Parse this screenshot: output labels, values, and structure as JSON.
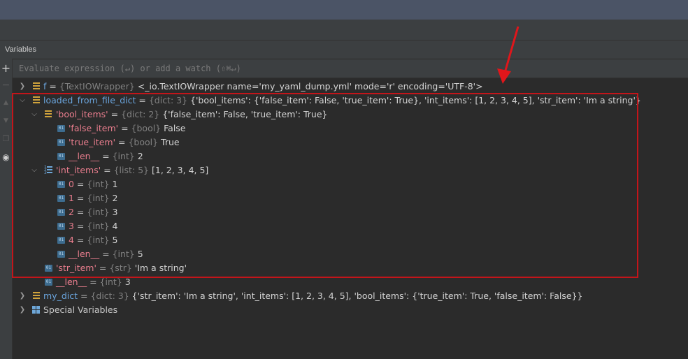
{
  "panel": {
    "title": "Variables"
  },
  "eval": {
    "placeholder": "Evaluate expression (↵) or add a watch (⇧⌘↵)"
  },
  "gutter_icons": [
    "plus-icon",
    "minus-icon",
    "up-icon",
    "down-icon",
    "copy-icon",
    "eye-icon"
  ],
  "rows": [
    {
      "name": "f",
      "eq": " = ",
      "type": "{TextIOWrapper}",
      "value": " <_io.TextIOWrapper name='my_yaml_dump.yml' mode='r' encoding='UTF-8'>"
    },
    {
      "name": "loaded_from_file_dict",
      "eq": " = ",
      "type": "{dict: 3}",
      "value": " {'bool_items': {'false_item': False, 'true_item': True}, 'int_items': [1, 2, 3, 4, 5], 'str_item': 'Im a string'}"
    },
    {
      "name": "'bool_items'",
      "eq": " = ",
      "type": "{dict: 2}",
      "value": " {'false_item': False, 'true_item': True}"
    },
    {
      "name": "'false_item'",
      "eq": " = ",
      "type": "{bool}",
      "value": " False"
    },
    {
      "name": "'true_item'",
      "eq": " = ",
      "type": "{bool}",
      "value": " True"
    },
    {
      "name": "__len__",
      "eq": " = ",
      "type": "{int}",
      "value": " 2"
    },
    {
      "name": "'int_items'",
      "eq": " = ",
      "type": "{list: 5}",
      "value": " [1, 2, 3, 4, 5]"
    },
    {
      "name": "0",
      "eq": " = ",
      "type": "{int}",
      "value": " 1"
    },
    {
      "name": "1",
      "eq": " = ",
      "type": "{int}",
      "value": " 2"
    },
    {
      "name": "2",
      "eq": " = ",
      "type": "{int}",
      "value": " 3"
    },
    {
      "name": "3",
      "eq": " = ",
      "type": "{int}",
      "value": " 4"
    },
    {
      "name": "4",
      "eq": " = ",
      "type": "{int}",
      "value": " 5"
    },
    {
      "name": "__len__",
      "eq": " = ",
      "type": "{int}",
      "value": " 5"
    },
    {
      "name": "'str_item'",
      "eq": " = ",
      "type": "{str}",
      "value": " 'Im a string'"
    },
    {
      "name": "__len__",
      "eq": " = ",
      "type": "{int}",
      "value": " 3"
    },
    {
      "name": "my_dict",
      "eq": " = ",
      "type": "{dict: 3}",
      "value": " {'str_item': 'Im a string', 'int_items': [1, 2, 3, 4, 5], 'bool_items': {'true_item': True, 'false_item': False}}"
    },
    {
      "name": "Special Variables",
      "eq": "",
      "type": "",
      "value": ""
    }
  ],
  "colors": {
    "highlight": "#c3151a",
    "name_key": "#e87d8d",
    "name_var": "#6aa4dc",
    "type": "#808080"
  }
}
